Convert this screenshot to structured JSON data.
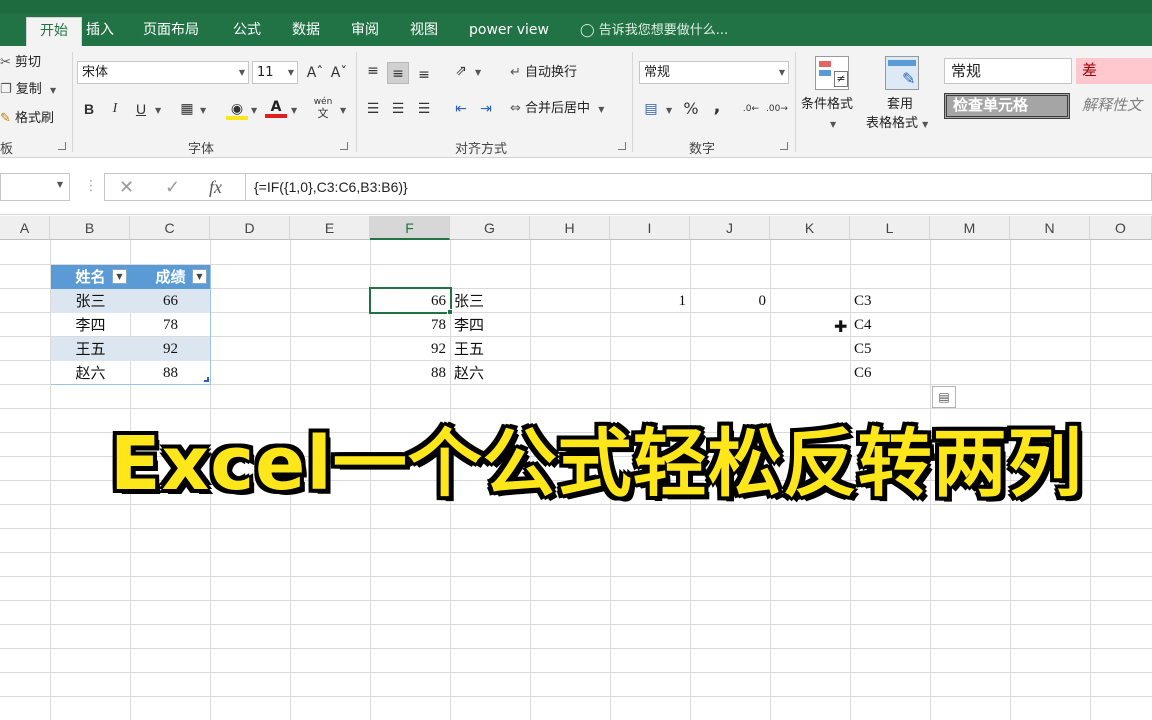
{
  "tabs": [
    {
      "label": "开始",
      "active": true
    },
    {
      "label": "插入"
    },
    {
      "label": "页面布局"
    },
    {
      "label": "公式"
    },
    {
      "label": "数据"
    },
    {
      "label": "审阅"
    },
    {
      "label": "视图"
    },
    {
      "label": "power view"
    }
  ],
  "tell_me": "告诉我您想要做什么...",
  "clipboard": {
    "cut": "剪切",
    "copy": "复制",
    "format_painter": "格式刷",
    "group_label": "板"
  },
  "font": {
    "name": "宋体",
    "size": "11",
    "group_label": "字体",
    "bold": "B",
    "italic": "I",
    "underline": "U",
    "phonetic": "wén"
  },
  "alignment": {
    "wrap_text": "自动换行",
    "merge_center": "合并后居中",
    "group_label": "对齐方式"
  },
  "number": {
    "format": "常规",
    "group_label": "数字",
    "percent": "%",
    "comma": ","
  },
  "styles": {
    "conditional_format": "条件格式",
    "table_format_1": "套用",
    "table_format_2": "表格格式",
    "normal": "常规",
    "bad": "差",
    "check_cell": "检查单元格",
    "explanatory": "解释性文"
  },
  "formula_bar": {
    "name_box": "",
    "formula": "{=IF({1,0},C3:C6,B3:B6)}"
  },
  "columns": [
    "A",
    "B",
    "C",
    "D",
    "E",
    "F",
    "G",
    "H",
    "I",
    "J",
    "K",
    "L",
    "M",
    "N",
    "O"
  ],
  "selected_column": "F",
  "table": {
    "headers": [
      "姓名",
      "成绩"
    ],
    "rows": [
      [
        "张三",
        "66"
      ],
      [
        "李四",
        "78"
      ],
      [
        "王五",
        "92"
      ],
      [
        "赵六",
        "88"
      ]
    ]
  },
  "result": {
    "rows": [
      [
        "66",
        "张三"
      ],
      [
        "78",
        "李四"
      ],
      [
        "92",
        "王五"
      ],
      [
        "88",
        "赵六"
      ]
    ]
  },
  "array_values": [
    "1",
    "0"
  ],
  "refs": [
    "C3",
    "C4",
    "C5",
    "C6"
  ],
  "overlay_title": "Excel一个公式轻松反转两列",
  "colors": {
    "ribbon_green": "#217346",
    "table_header": "#5b9bd5",
    "table_band": "#dce6f1",
    "title_yellow": "#fde71b"
  }
}
